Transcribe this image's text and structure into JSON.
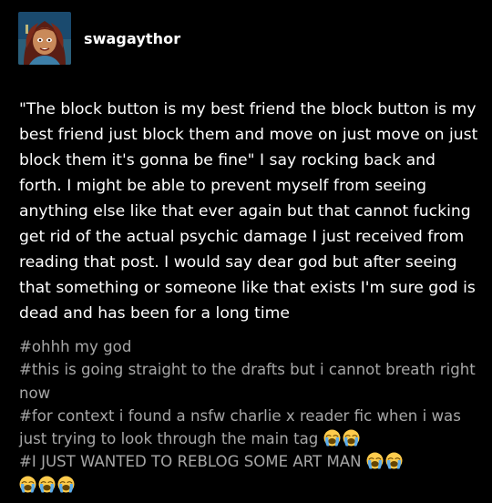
{
  "post": {
    "username": "swagaythor",
    "body": "\"The block button is my best friend the block button is my best friend just block them and move on just move on just block them it's gonna be fine\" I say rocking back and forth. I might be able to prevent myself from seeing anything else like that ever again but that cannot fucking get rid of the actual psychic damage I just received from reading that post. I would say dear god but after seeing that something or someone like that exists I'm sure god is dead and has been for a long time",
    "tags": [
      "#ohhh my god",
      "#this is going straight to the drafts but i cannot breath right now",
      "#for context i found a nsfw charlie x reader fic when i was just trying to look through the main tag",
      "#I JUST WANTED TO REBLOG SOME ART MAN"
    ],
    "tag_emojis": [
      "loudly-crying-face",
      "loudly-crying-face",
      "loudly-crying-face",
      "loudly-crying-face",
      "loudly-crying-face",
      "loudly-crying-face",
      "loudly-crying-face"
    ]
  },
  "colors": {
    "background": "#000000",
    "text": "#ffffff",
    "tags": "#a6a6a6",
    "emoji": "#ffcc4d"
  }
}
